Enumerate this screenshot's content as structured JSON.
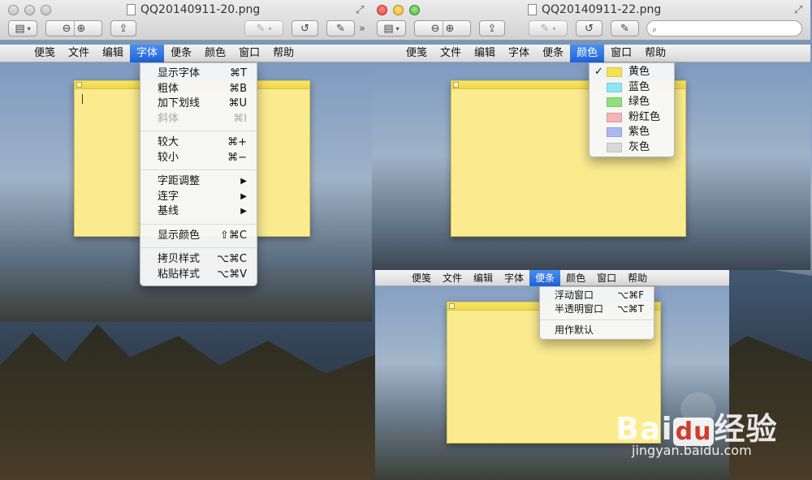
{
  "windows": {
    "left": {
      "title": "QQ20140911-20.png"
    },
    "right": {
      "title": "QQ20140911-22.png",
      "search_placeholder": ""
    }
  },
  "menubar": [
    "便笺",
    "文件",
    "编辑",
    "字体",
    "便条",
    "颜色",
    "窗口",
    "帮助"
  ],
  "font_menu": {
    "items": [
      {
        "label": "显示字体",
        "shortcut": "⌘T"
      },
      {
        "label": "粗体",
        "shortcut": "⌘B"
      },
      {
        "label": "加下划线",
        "shortcut": "⌘U"
      },
      {
        "label": "斜体",
        "shortcut": "⌘I"
      },
      {
        "label": "较大",
        "shortcut": "⌘+"
      },
      {
        "label": "较小",
        "shortcut": "⌘−"
      },
      {
        "label": "字距调整",
        "shortcut": "▶"
      },
      {
        "label": "连字",
        "shortcut": "▶"
      },
      {
        "label": "基线",
        "shortcut": "▶"
      },
      {
        "label": "显示颜色",
        "shortcut": "⇧⌘C"
      },
      {
        "label": "拷贝样式",
        "shortcut": "⌥⌘C"
      },
      {
        "label": "粘贴样式",
        "shortcut": "⌥⌘V"
      }
    ]
  },
  "color_menu": {
    "checked": "✓",
    "items": [
      {
        "label": "黄色",
        "color": "#f5e24f"
      },
      {
        "label": "蓝色",
        "color": "#8ee7f6"
      },
      {
        "label": "绿色",
        "color": "#8de07c"
      },
      {
        "label": "粉红色",
        "color": "#f3b3b9"
      },
      {
        "label": "紫色",
        "color": "#a9b8f0"
      },
      {
        "label": "灰色",
        "color": "#d9d9d9"
      }
    ]
  },
  "note_menu": {
    "items": [
      {
        "label": "浮动窗口",
        "shortcut": "⌥⌘F"
      },
      {
        "label": "半透明窗口",
        "shortcut": "⌥⌘T"
      },
      {
        "label": "用作默认",
        "shortcut": ""
      }
    ]
  },
  "icons": {
    "apple": "",
    "search": "⌕",
    "zoom_out": "⊖",
    "zoom_in": "⊕",
    "share": "⇪",
    "rotate": "↺",
    "edit": "✎",
    "sidebar": "▤",
    "expand": "⤢",
    "more": "»"
  },
  "watermark": {
    "brand_left": "Bai",
    "brand_du": "du",
    "brand_right": "经验",
    "url": "jingyan.baidu.com"
  }
}
